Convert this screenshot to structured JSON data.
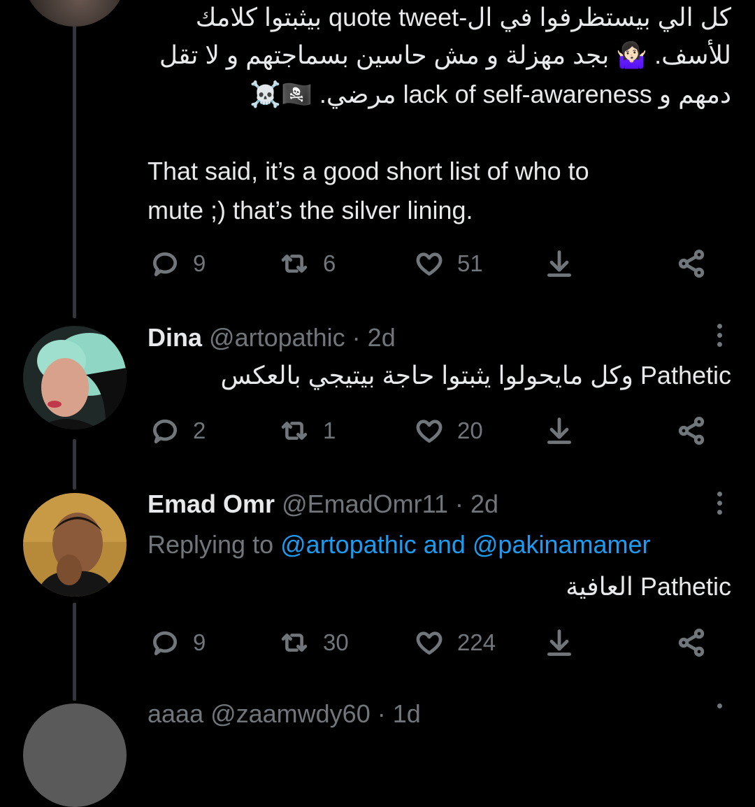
{
  "tweet1": {
    "text_ar_1": "كل الي بيستظرفوا في ال-quote tweet بيثبتوا كلامك",
    "text_ar_2": "للأسف. 🤷🏻‍♀️ بجد مهزلة و مش حاسين بسماجتهم و لا تقل",
    "text_ar_3": "دمهم و lack of self-awareness مرضي. 🏴‍☠️☠️",
    "text_en_1": "That said, it’s a good short list of who to",
    "text_en_2": "mute ;) that’s the silver lining.",
    "replies": "9",
    "retweets": "6",
    "likes": "51"
  },
  "tweet2": {
    "name": "Dina",
    "handle": "@artopathic · 2d",
    "text": "Pathetic وكل مايحولوا يثبتوا حاجة بيتيجي بالعكس",
    "replies": "2",
    "retweets": "1",
    "likes": "20"
  },
  "tweet3": {
    "name": "Emad Omr",
    "handle": "@EmadOmr11 · 2d",
    "replying_prefix": "Replying to",
    "mention1": "@artopathic",
    "and": "and",
    "mention2": "@pakinamamer",
    "text": "Pathetic العافية",
    "replies": "9",
    "retweets": "30",
    "likes": "224"
  },
  "tweet4": {
    "partial_header": "aaaa @zaamwdy60 · 1d"
  },
  "icons": {
    "reply": "reply-icon",
    "retweet": "retweet-icon",
    "like": "heart-icon",
    "download": "download-icon",
    "share": "share-icon",
    "more": "more-options-icon"
  },
  "colors": {
    "background": "#000000",
    "text": "#e7e9ea",
    "secondary": "#71767b",
    "link": "#1d9bf0"
  }
}
